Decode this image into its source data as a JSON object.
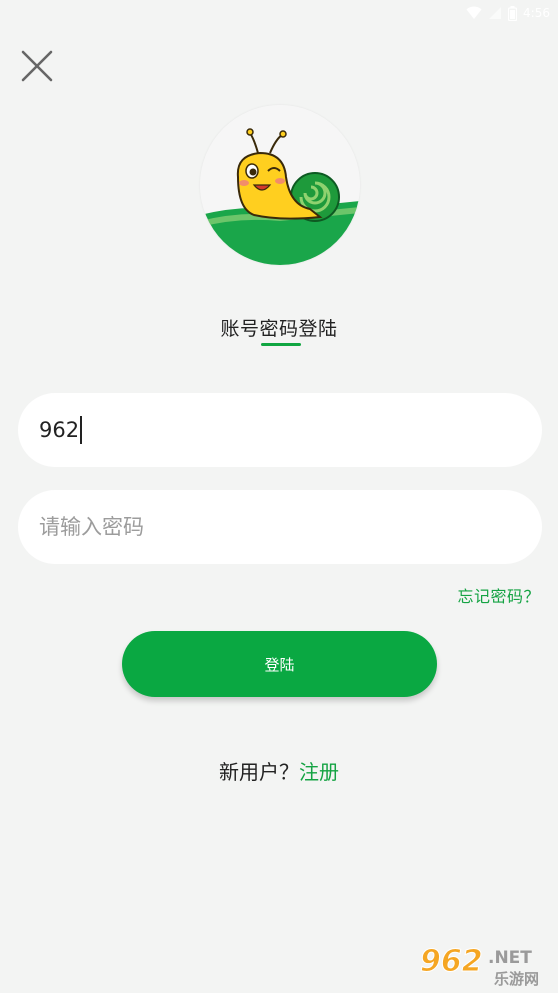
{
  "status_bar": {
    "time": "4:56",
    "icons": [
      "wifi-icon",
      "signal-icon",
      "battery-icon"
    ]
  },
  "header": {
    "close_icon": "close-icon"
  },
  "logo": {
    "name": "snail-mascot"
  },
  "login": {
    "title": "账号密码登陆",
    "username_value": "962",
    "password_placeholder": "请输入密码",
    "forgot_label": "忘记密码？",
    "submit_label": "登陆",
    "register_prompt": "新用户？",
    "register_link": "注册"
  },
  "watermark": {
    "text_main": "962",
    "text_net": ".NET",
    "text_sub": "乐游网"
  },
  "colors": {
    "accent": "#0aa842",
    "background": "#f3f4f3",
    "link": "#14a343"
  }
}
